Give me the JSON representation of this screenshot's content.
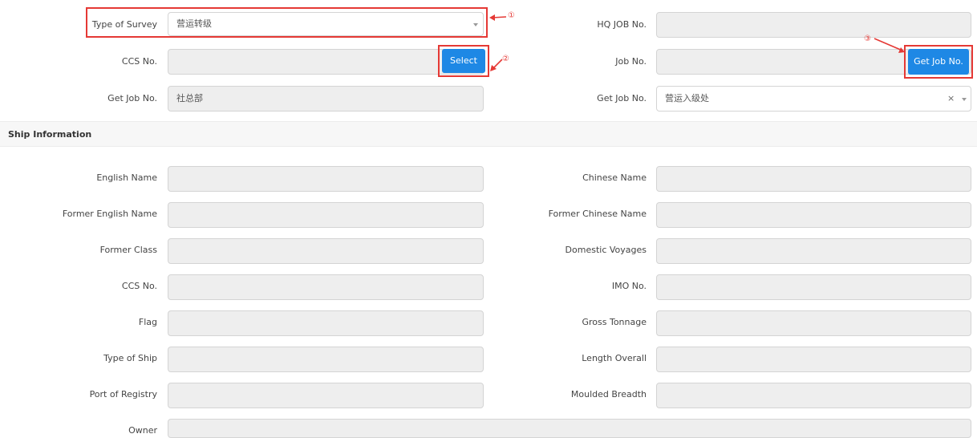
{
  "top_form": {
    "type_of_survey": {
      "label": "Type of Survey",
      "value": "营运转级"
    },
    "hq_job_no": {
      "label": "HQ JOB No.",
      "value": ""
    },
    "ccs_no": {
      "label": "CCS No.",
      "value": ""
    },
    "select_button": "Select",
    "job_no": {
      "label": "Job No.",
      "value": ""
    },
    "get_job_no_button": "Get Job No.",
    "get_job_no_left": {
      "label": "Get Job No.",
      "value": "社总部"
    },
    "get_job_no_right": {
      "label": "Get Job No.",
      "value": "营运入级处"
    }
  },
  "ship_information": {
    "title": "Ship Information",
    "english_name": {
      "label": "English Name",
      "value": ""
    },
    "chinese_name": {
      "label": "Chinese Name",
      "value": ""
    },
    "former_english_name": {
      "label": "Former English Name",
      "value": ""
    },
    "former_chinese_name": {
      "label": "Former Chinese Name",
      "value": ""
    },
    "former_class": {
      "label": "Former Class",
      "value": ""
    },
    "domestic_voyages": {
      "label": "Domestic Voyages",
      "value": ""
    },
    "ccs_no": {
      "label": "CCS No.",
      "value": ""
    },
    "imo_no": {
      "label": "IMO No.",
      "value": ""
    },
    "flag": {
      "label": "Flag",
      "value": ""
    },
    "gross_tonnage": {
      "label": "Gross Tonnage",
      "value": ""
    },
    "type_of_ship": {
      "label": "Type of Ship",
      "value": ""
    },
    "length_overall": {
      "label": "Length Overall",
      "value": ""
    },
    "port_of_registry": {
      "label": "Port of Registry",
      "value": ""
    },
    "moulded_breadth": {
      "label": "Moulded Breadth",
      "value": ""
    },
    "owner": {
      "label": "Owner",
      "value": ""
    }
  },
  "annotations": {
    "marker_1": "①",
    "marker_2": "②",
    "marker_3": "③",
    "color": "#e53935"
  },
  "icons": {
    "dropdown": "chevron-down-icon",
    "clear": "clear-icon"
  },
  "colors": {
    "button": "#1e88e5",
    "readonly_field": "#eeeeee",
    "highlight": "#e53935"
  }
}
